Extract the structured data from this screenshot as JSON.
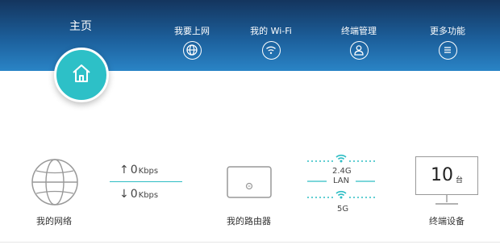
{
  "nav": {
    "home_label": "主页",
    "items": [
      {
        "label": "我要上网",
        "icon": "globe-icon"
      },
      {
        "label": "我的 Wi-Fi",
        "icon": "wifi-icon"
      },
      {
        "label": "终端管理",
        "icon": "user-icon"
      },
      {
        "label": "更多功能",
        "icon": "menu-icon"
      }
    ]
  },
  "topology": {
    "internet_label": "我的网络",
    "upload": {
      "arrow": "↑",
      "value": "0",
      "unit": "Kbps"
    },
    "download": {
      "arrow": "↓",
      "value": "0",
      "unit": "Kbps"
    },
    "router_label": "我的路由器",
    "band_24": "2.4G",
    "lan_label": "LAN",
    "band_5": "5G",
    "device_count": "10",
    "device_unit": "台",
    "devices_label": "终端设备"
  },
  "colors": {
    "header_dark": "#14355e",
    "header_light": "#2a84c6",
    "accent_teal": "#2dc0c7"
  }
}
